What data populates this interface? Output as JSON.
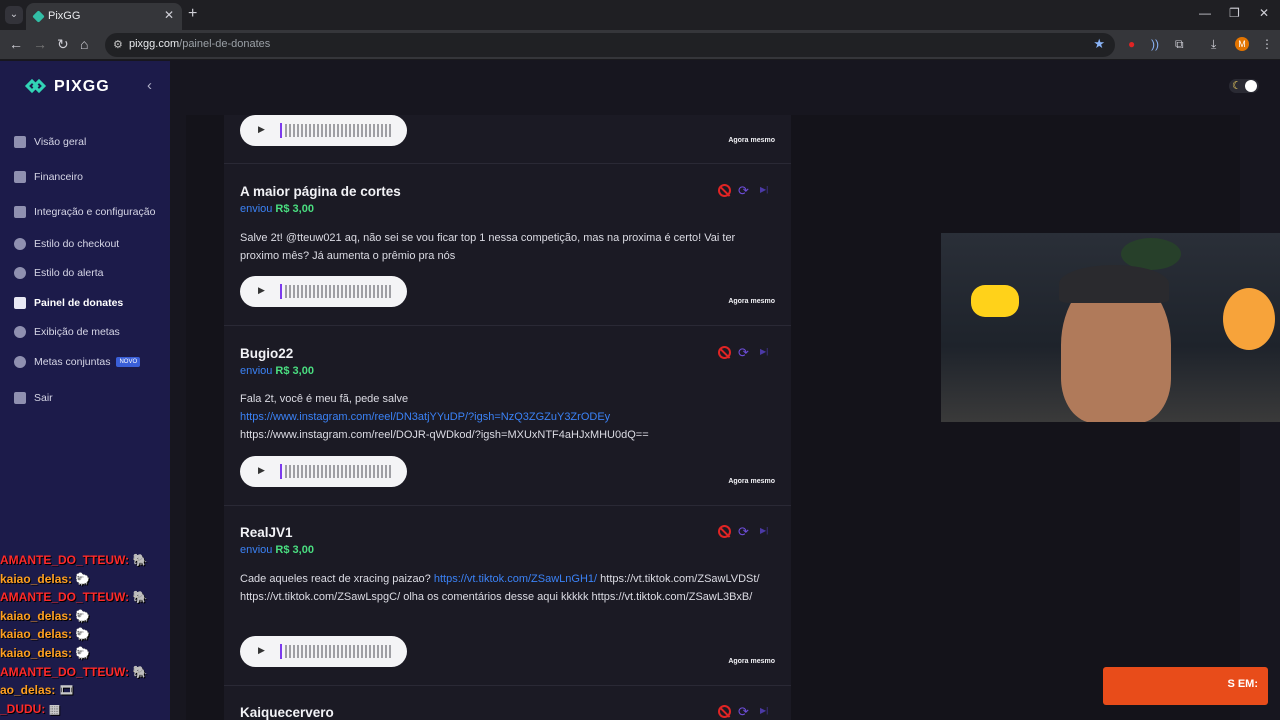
{
  "browser": {
    "tab_title": "PixGG",
    "url_domain": "pixgg.com",
    "url_path": "/painel-de-donates",
    "profile_initial": "M"
  },
  "sidebar": {
    "logo": "PIXGG",
    "items": [
      {
        "label": "Visão geral",
        "icon": "home-icon"
      },
      {
        "label": "Financeiro",
        "icon": "wallet-icon"
      },
      {
        "label": "Integração e configuração",
        "icon": "settings-icon"
      },
      {
        "label": "Estilo do checkout",
        "icon": "palette-icon"
      },
      {
        "label": "Estilo do alerta",
        "icon": "palette-icon"
      },
      {
        "label": "Painel de donates",
        "icon": "donate-icon",
        "active": true
      },
      {
        "label": "Exibição de metas",
        "icon": "star-icon"
      },
      {
        "label": "Metas conjuntas",
        "icon": "target-icon",
        "badge": "NOVO"
      },
      {
        "label": "Sair",
        "icon": "logout-icon"
      }
    ]
  },
  "chat": [
    {
      "user": "AMANTE_DO_TTEUW:",
      "color": "red"
    },
    {
      "user": "kaiao_delas:",
      "color": "orange"
    },
    {
      "user": "AMANTE_DO_TTEUW:",
      "color": "red"
    },
    {
      "user": "kaiao_delas:",
      "color": "orange"
    },
    {
      "user": "kaiao_delas:",
      "color": "orange"
    },
    {
      "user": "kaiao_delas:",
      "color": "orange"
    },
    {
      "user": "AMANTE_DO_TTEUW:",
      "color": "red"
    },
    {
      "user": "ao_delas:",
      "color": "orange"
    },
    {
      "user": "_DUDU:",
      "color": "red"
    }
  ],
  "donations": [
    {
      "name": "",
      "sent_label": "",
      "amount": "",
      "message": [],
      "time": "Agora mesmo"
    },
    {
      "name": "A maior página de cortes",
      "sent_label": "enviou",
      "amount": "R$ 3,00",
      "message": [
        {
          "text": "Salve 2t! @tteuw021 aq, não sei se vou ficar top 1 nessa competição, mas na proxima é certo! Vai ter proximo mês? Já aumenta o prêmio pra nós"
        }
      ],
      "time": "Agora mesmo"
    },
    {
      "name": "Bugio22",
      "sent_label": "enviou",
      "amount": "R$ 3,00",
      "message": [
        {
          "text": "Fala 2t, você é meu fã, pede salve"
        },
        {
          "link": "https://www.instagram.com/reel/DN3atjYYuDP/?igsh=NzQ3ZGZuY3ZrODEy"
        },
        {
          "text": "https://www.instagram.com/reel/DOJR-qWDkod/?igsh=MXUxNTF4aHJxMHU0dQ=="
        }
      ],
      "time": "Agora mesmo"
    },
    {
      "name": "RealJV1",
      "sent_label": "enviou",
      "amount": "R$ 3,00",
      "message_text_1": "Cade aqueles react de xracing paizao?",
      "message_link_1": "https://vt.tiktok.com/ZSawLnGH1/",
      "message_rest": "https://vt.tiktok.com/ZSawLVDSt/ https://vt.tiktok.com/ZSawLspgC/ olha os comentários desse aqui kkkkk https://vt.tiktok.com/ZSawL3BxB/",
      "time": "Agora mesmo"
    },
    {
      "name": "Kaiquecervero"
    }
  ],
  "overlay": {
    "banner_text": "S EM:"
  },
  "colors": {
    "sidebar_bg": "#1c1b4a",
    "accent_blue": "#3b82f6",
    "amount_green": "#4ade80",
    "block_red": "#e02424"
  }
}
